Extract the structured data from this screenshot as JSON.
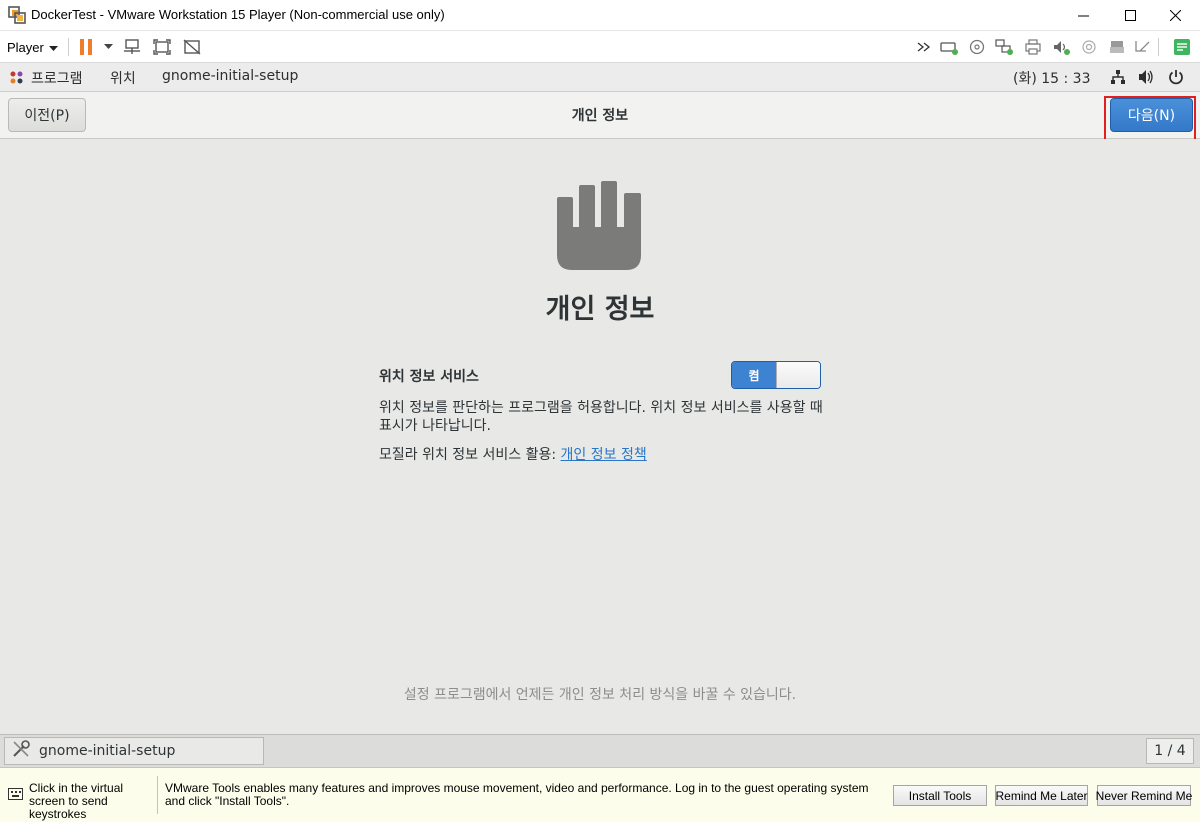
{
  "window": {
    "title": "DockerTest - VMware Workstation 15 Player (Non-commercial use only)",
    "controls": [
      "minimize-icon",
      "maximize-icon",
      "close-icon"
    ]
  },
  "toolbar": {
    "player_label": "Player",
    "left_icons": [
      "pause-icon",
      "send-ctrl-alt-del-icon",
      "fullscreen-icon",
      "unity-icon"
    ],
    "right_icons": [
      "more-devices-icon",
      "hard-disk-icon",
      "cd-dvd-icon",
      "network-adapter-icon",
      "usb-icon",
      "sound-card-icon",
      "floppy-icon",
      "printer-icon",
      "display-icon",
      "message-log-icon"
    ],
    "accent": "#ef7d2b"
  },
  "gnome_bar": {
    "menus": [
      "프로그램",
      "위치",
      "gnome-initial-setup"
    ],
    "clock": "(화) 15 : 33",
    "status_icons": [
      "network-icon",
      "volume-icon",
      "power-icon"
    ]
  },
  "header": {
    "prev_label": "이전(P)",
    "title": "개인 정보",
    "next_label": "다음(N)"
  },
  "privacy": {
    "heading": "개인 정보",
    "location_label": "위치 정보 서비스",
    "toggle_state": "켬",
    "description": "위치 정보를 판단하는 프로그램을 허용합니다. 위치 정보 서비스를 사용할 때 표시가 나타납니다.",
    "policy_prefix": "모질라 위치 정보 서비스 활용: ",
    "policy_link": "개인 정보 정책",
    "footer_note": "설정 프로그램에서 언제든 개인 정보 처리 방식을 바꿀 수 있습니다."
  },
  "taskbar": {
    "item_label": "gnome-initial-setup",
    "pager": "1 / 4"
  },
  "notification": {
    "hint": "Click in the virtual screen to send keystrokes",
    "message": "VMware Tools enables many features and improves mouse movement, video and performance. Log in to the guest operating system and click \"Install Tools\".",
    "buttons": [
      "Install Tools",
      "Remind Me Later",
      "Never Remind Me"
    ]
  }
}
